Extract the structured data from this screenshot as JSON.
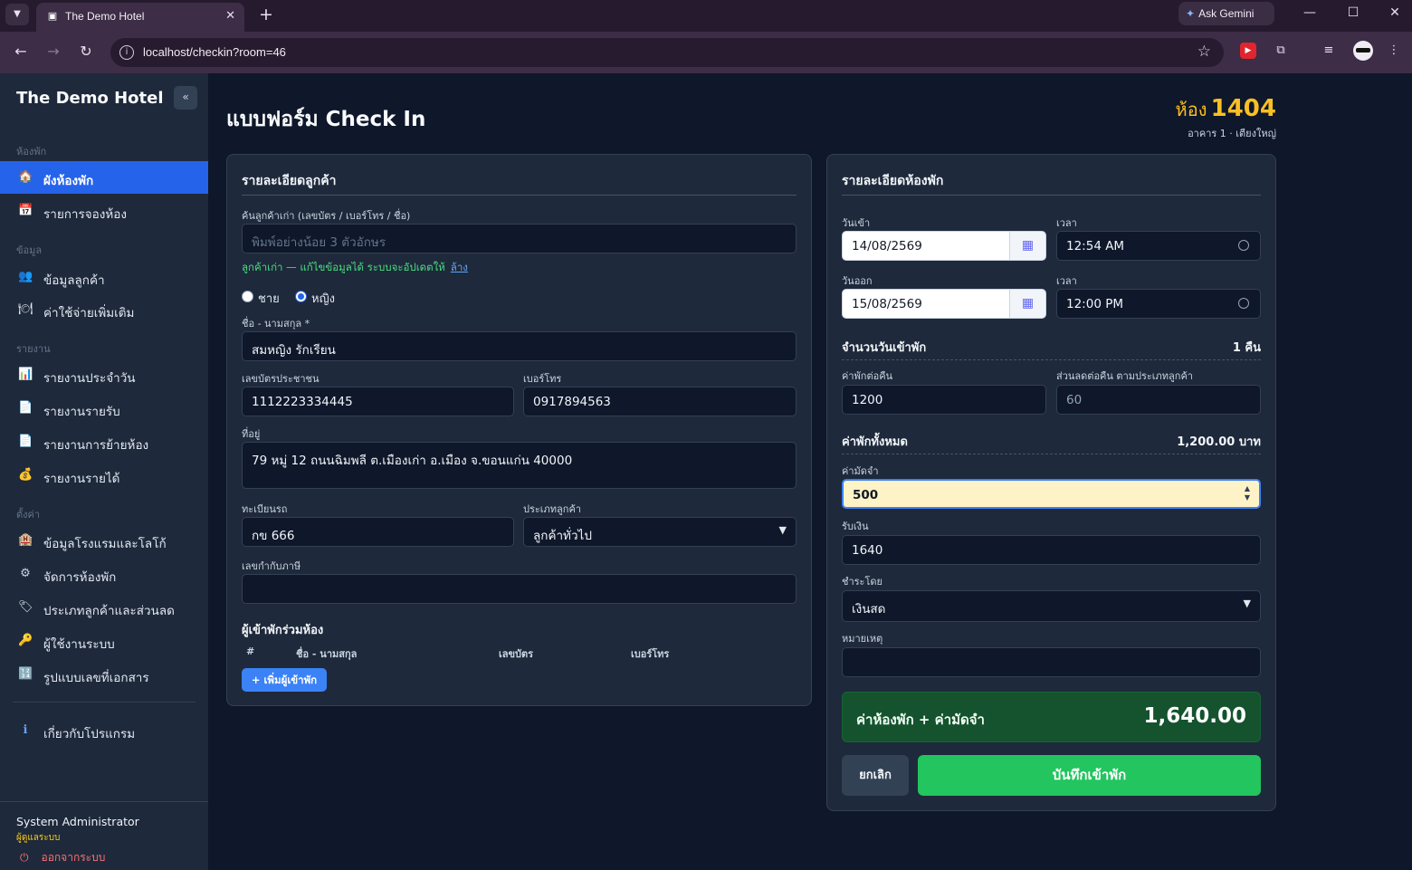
{
  "browser": {
    "tab_title": "The Demo Hotel",
    "tab_close": "✕",
    "new_tab": "+",
    "gemini_label": "Ask Gemini",
    "url": "localhost/checkin?room=46"
  },
  "sidebar": {
    "brand": "The Demo Hotel",
    "collapse_label": "«",
    "sections": {
      "rooms": "ห้องพัก",
      "data": "ข้อมูล",
      "reports": "รายงาน",
      "settings": "ตั้งค่า"
    },
    "items": [
      {
        "label": "ผังห้องพัก",
        "icon": "house-icon",
        "glyph": "🏠"
      },
      {
        "label": "รายการจองห้อง",
        "icon": "calendar-icon",
        "glyph": "📅"
      },
      {
        "label": "ข้อมูลลูกค้า",
        "icon": "users-icon",
        "glyph": "👥"
      },
      {
        "label": "ค่าใช้จ่ายเพิ่มเติม",
        "icon": "dish-icon",
        "glyph": "🍽"
      },
      {
        "label": "รายงานประจำวัน",
        "icon": "chart-icon",
        "glyph": "📊"
      },
      {
        "label": "รายงานรายรับ",
        "icon": "doc-icon",
        "glyph": "📄"
      },
      {
        "label": "รายงานการย้ายห้อง",
        "icon": "doc-icon",
        "glyph": "📄"
      },
      {
        "label": "รายงานรายได้",
        "icon": "money-bag-icon",
        "glyph": "💰"
      },
      {
        "label": "ข้อมูลโรงแรมและโลโก้",
        "icon": "hotel-icon",
        "glyph": "🏨"
      },
      {
        "label": "จัดการห้องพัก",
        "icon": "gear-icon",
        "glyph": "⚙"
      },
      {
        "label": "ประเภทลูกค้าและส่วนลด",
        "icon": "tag-icon",
        "glyph": "🏷"
      },
      {
        "label": "ผู้ใช้งานระบบ",
        "icon": "key-icon",
        "glyph": "🔑"
      },
      {
        "label": "รูปแบบเลขที่เอกสาร",
        "icon": "numbers-icon",
        "glyph": "🔢"
      },
      {
        "label": "เกี่ยวกับโปรแกรม",
        "icon": "info-icon",
        "glyph": "ℹ"
      }
    ],
    "user": {
      "name": "System Administrator",
      "role": "ผู้ดูแลระบบ",
      "logout": "ออกจากระบบ",
      "logout_glyph": "⏻"
    }
  },
  "header": {
    "title": "แบบฟอร์ม Check In",
    "room_label": "ห้อง",
    "room_number": "1404",
    "room_sub": "อาคาร 1 · เตียงใหญ่"
  },
  "customer": {
    "heading": "รายละเอียดลูกค้า",
    "search_label": "ค้นลูกค้าเก่า (เลขบัตร / เบอร์โทร / ชื่อ)",
    "search_placeholder": "พิมพ์อย่างน้อย 3 ตัวอักษร",
    "hint": "ลูกค้าเก่า — แก้ไขข้อมูลได้ ระบบจะอัปเดตให้",
    "hint_link": "ล้าง",
    "gender_male": "ชาย",
    "gender_female": "หญิง",
    "name_label": "ชื่อ - นามสกุล *",
    "name_value": "สมหญิง รักเรียน",
    "id_label": "เลขบัตรประชาชน",
    "id_value": "1112223334445",
    "phone_label": "เบอร์โทร",
    "phone_value": "0917894563",
    "address_label": "ที่อยู่",
    "address_value": "79 หมู่ 12 ถนนฉิมพลี ต.เมืองเก่า อ.เมือง จ.ขอนแก่น 40000",
    "plate_label": "ทะเบียนรถ",
    "plate_value": "กข 666",
    "type_label": "ประเภทลูกค้า",
    "type_value": "ลูกค้าทั่วไป",
    "tax_label": "เลขกำกับภาษี",
    "tax_value": "",
    "co_heading": "ผู้เข้าพักร่วมห้อง",
    "co_cols": [
      "#",
      "ชื่อ - นามสกุล",
      "เลขบัตร",
      "เบอร์โทร"
    ],
    "add_button": "+ เพิ่มผู้เข้าพัก"
  },
  "room": {
    "heading": "รายละเอียดห้องพัก",
    "checkin_label": "วันเข้า",
    "checkin_date": "14/08/2569",
    "checkin_time_label": "เวลา",
    "checkin_time": "12:54 AM",
    "checkout_label": "วันออก",
    "checkout_date": "15/08/2569",
    "checkout_time_label": "เวลา",
    "checkout_time": "12:00 PM",
    "nights_label": "จำนวนวันเข้าพัก",
    "nights_value": "1 คืน",
    "rate_label": "ค่าพักต่อคืน",
    "rate_value": "1200",
    "discount_label": "ส่วนลดต่อคืน ตามประเภทลูกค้า",
    "discount_value": "60",
    "total_label": "ค่าพักทั้งหมด",
    "total_value": "1,200.00 บาท",
    "deposit_label": "ค่ามัดจำ",
    "deposit_value": "500",
    "received_label": "รับเงิน",
    "received_value": "1640",
    "pay_label": "ชำระโดย",
    "pay_value": "เงินสด",
    "note_label": "หมายเหตุ",
    "note_value": "",
    "grand_label": "ค่าห้องพัก + ค่ามัดจำ",
    "grand_value": "1,640.00",
    "cancel_button": "ยกเลิก",
    "save_button": "บันทึกเข้าพัก"
  }
}
